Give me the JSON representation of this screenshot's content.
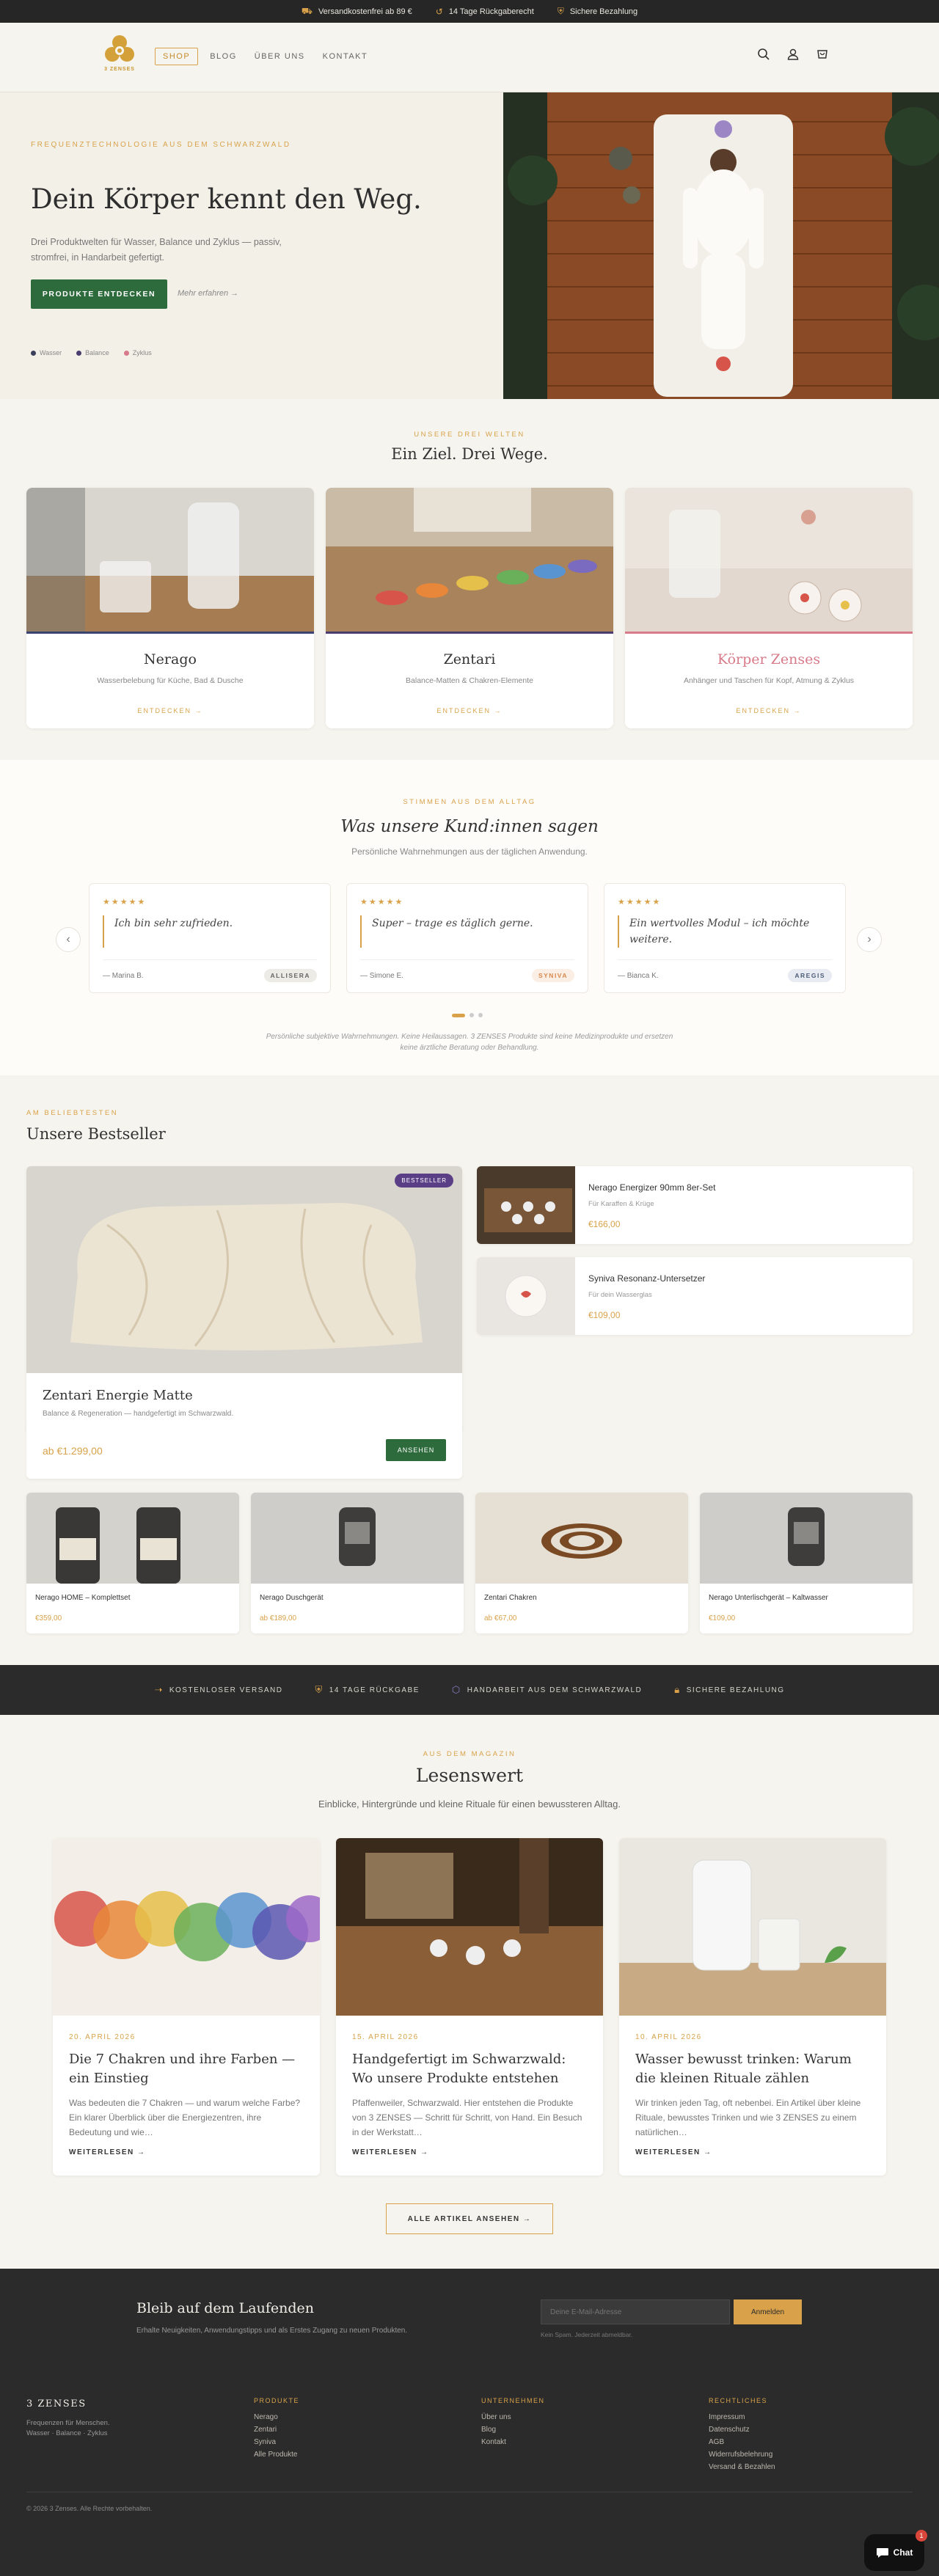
{
  "announcement": {
    "items": [
      {
        "icon": "truck-icon",
        "text": "Versandkostenfrei ab 89 €"
      },
      {
        "icon": "return-arrow-icon",
        "text": "14 Tage Rückgaberecht"
      },
      {
        "icon": "shield-icon",
        "text": "Sichere Bezahlung"
      }
    ]
  },
  "header": {
    "logo_text": "3 ZENSES",
    "nav": [
      "SHOP",
      "BLOG",
      "ÜBER UNS",
      "KONTAKT"
    ],
    "icons": [
      "search-icon",
      "account-icon",
      "cart-icon"
    ]
  },
  "hero": {
    "eyebrow": "FREQUENZTECHNOLOGIE AUS DEM SCHWARZWALD",
    "title": "Dein Körper kennt den Weg.",
    "subtitle": "Drei Produktwelten für Wasser, Balance und Zyklus — passiv, stromfrei, in Handarbeit gefertigt.",
    "cta": "PRODUKTE ENTDECKEN",
    "more": "Mehr erfahren →",
    "legend": [
      {
        "label": "Wasser",
        "color": "#3b3f5c"
      },
      {
        "label": "Balance",
        "color": "#4a3c6e"
      },
      {
        "label": "Zyklus",
        "color": "#d77a8a"
      }
    ]
  },
  "worlds": {
    "eyebrow": "UNSERE DREI WELTEN",
    "title": "Ein Ziel. Drei Wege.",
    "cards": [
      {
        "title": "Nerago",
        "desc": "Wasserbelebung für Küche, Bad & Dusche",
        "cta": "ENTDECKEN →",
        "accent": "#3b4470"
      },
      {
        "title": "Zentari",
        "desc": "Balance-Matten & Chakren-Elemente",
        "cta": "ENTDECKEN →",
        "accent": "#4a3c6e"
      },
      {
        "title": "Körper Zenses",
        "desc": "Anhänger und Taschen für Kopf, Atmung & Zyklus",
        "cta": "ENTDECKEN →",
        "accent": "#d77a8a"
      }
    ]
  },
  "testimonials": {
    "eyebrow": "STIMMEN AUS DEM ALLTAG",
    "title": "Was unsere Kund:innen sagen",
    "subtitle": "Persönliche Wahrnehmungen aus der täglichen Anwendung.",
    "items": [
      {
        "stars": "★★★★★",
        "quote": "Ich bin sehr zufrieden.",
        "author": "— Marina B.",
        "tag": "ALLISERA",
        "tag_bg": "#ecebe6",
        "tag_color": "#666"
      },
      {
        "stars": "★★★★★",
        "quote": "Super – trage es täglich gerne.",
        "author": "— Simone E.",
        "tag": "SYNIVA",
        "tag_bg": "#fbeee4",
        "tag_color": "#d9874a"
      },
      {
        "stars": "★★★★★",
        "quote": "Ein wertvolles Modul – ich möchte weitere.",
        "author": "— Bianca K.",
        "tag": "AREGIS",
        "tag_bg": "#e8ebf1",
        "tag_color": "#4c5d7a"
      }
    ],
    "disclaimer": "Persönliche subjektive Wahrnehmungen. Keine Heilaussagen. 3 ZENSES Produkte sind keine Medizinprodukte und ersetzen keine ärztliche Beratung oder Behandlung."
  },
  "bestseller": {
    "eyebrow": "AM BELIEBTESTEN",
    "title": "Unsere Bestseller",
    "featured": {
      "badge": "BESTSELLER",
      "name": "Zentari Energie Matte",
      "desc": "Balance & Regeneration — handgefertigt im Schwarzwald.",
      "price": "ab €1.299,00",
      "button": "ANSEHEN"
    },
    "side": [
      {
        "name": "Nerago Energizer 90mm 8er-Set",
        "desc": "Für Karaffen & Krüge",
        "price": "€166,00"
      },
      {
        "name": "Syniva Resonanz-Untersetzer",
        "desc": "Für dein Wasserglas",
        "price": "€109,00"
      }
    ],
    "grid": [
      {
        "name": "Nerago HOME – Komplettset",
        "price": "€359,00"
      },
      {
        "name": "Nerago Duschgerät",
        "price": "ab €189,00"
      },
      {
        "name": "Zentari Chakren",
        "price": "ab €67,00"
      },
      {
        "name": "Nerago Unterlischgerät – Kaltwasser",
        "price": "€109,00"
      }
    ]
  },
  "trust": [
    {
      "icon": "arrow-icon",
      "text": "KOSTENLOSER VERSAND"
    },
    {
      "icon": "shield-icon",
      "text": "14 TAGE RÜCKGABE"
    },
    {
      "icon": "hexagon-icon",
      "text": "HANDARBEIT AUS DEM SCHWARZWALD"
    },
    {
      "icon": "lock-icon",
      "text": "SICHERE BEZAHLUNG"
    }
  ],
  "blog": {
    "eyebrow": "AUS DEM MAGAZIN",
    "title": "Lesenswert",
    "subtitle": "Einblicke, Hintergründe und kleine Rituale für einen bewussteren Alltag.",
    "posts": [
      {
        "date": "20. APRIL 2026",
        "title": "Die 7 Chakren und ihre Farben — ein Einstieg",
        "excerpt": "Was bedeuten die 7 Chakren — und warum welche Farbe? Ein klarer Überblick über die Energiezentren, ihre Bedeutung und wie…",
        "cta": "WEITERLESEN →"
      },
      {
        "date": "15. APRIL 2026",
        "title": "Handgefertigt im Schwarzwald: Wo unsere Produkte entstehen",
        "excerpt": "Pfaffenweiler, Schwarzwald. Hier entstehen die Produkte von 3 ZENSES — Schritt für Schritt, von Hand. Ein Besuch in der Werkstatt…",
        "cta": "WEITERLESEN →"
      },
      {
        "date": "10. APRIL 2026",
        "title": "Wasser bewusst trinken: Warum die kleinen Rituale zählen",
        "excerpt": "Wir trinken jeden Tag, oft nebenbei. Ein Artikel über kleine Rituale, bewusstes Trinken und wie 3 ZENSES zu einem natürlichen…",
        "cta": "WEITERLESEN →"
      }
    ],
    "all_button": "ALLE ARTIKEL ANSEHEN →"
  },
  "footer": {
    "newsletter_title": "Bleib auf dem Laufenden",
    "newsletter_text": "Erhalte Neuigkeiten, Anwendungstipps und als Erstes Zugang zu neuen Produkten.",
    "email_placeholder": "Deine E-Mail-Adresse",
    "subscribe": "Anmelden",
    "note": "Kein Spam. Jederzeit abmeldbar.",
    "brand": "3 ZENSES",
    "tagline": "Frequenzen für Menschen. Wasser · Balance · Zyklus",
    "columns": [
      {
        "title": "PRODUKTE",
        "links": [
          "Nerago",
          "Zentari",
          "Syniva",
          "Alle Produkte"
        ]
      },
      {
        "title": "UNTERNEHMEN",
        "links": [
          "Über uns",
          "Blog",
          "Kontakt"
        ]
      },
      {
        "title": "RECHTLICHES",
        "links": [
          "Impressum",
          "Datenschutz",
          "AGB",
          "Widerrufsbelehrung",
          "Versand & Bezahlen"
        ]
      }
    ],
    "copyright": "© 2026 3 Zenses. Alle Rechte vorbehalten.",
    "chat_label": "Chat",
    "chat_badge": "1"
  }
}
